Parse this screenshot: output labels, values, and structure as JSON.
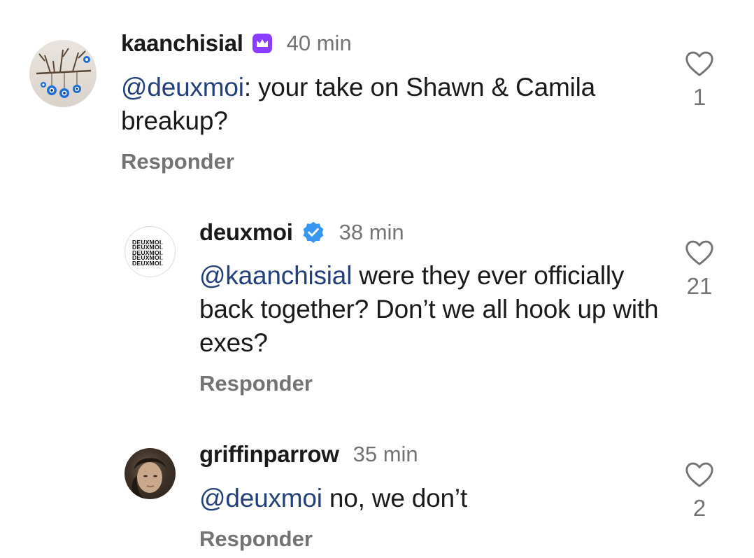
{
  "comments": [
    {
      "username": "kaanchisial",
      "badge_icon": "crown-badge-icon",
      "timestamp": "40 min",
      "mention": "@deuxmoi",
      "text_after_mention": ": your take on Shawn & Camila breakup?",
      "reply_label": "Responder",
      "likes": "1"
    },
    {
      "username": "deuxmoi",
      "badge_icon": "verified-badge-icon",
      "timestamp": "38 min",
      "avatar_text": [
        "DEUXMOI.",
        "DEUXMOI.",
        "DEUXMOI.",
        "DEUXMOI.",
        "DEUXMOI."
      ],
      "mention": "@kaanchisial",
      "text_after_mention": " were they ever officially back together? Don’t we all hook up with exes?",
      "reply_label": "Responder",
      "likes": "21"
    },
    {
      "username": "griffinparrow",
      "timestamp": "35 min",
      "mention": "@deuxmoi",
      "text_after_mention": " no, we don’t",
      "reply_label": "Responder",
      "likes": "2"
    }
  ],
  "colors": {
    "mention": "#24407a",
    "secondary_text": "#737373",
    "verified_blue": "#3897f0",
    "crown_purple": "#8b3dff"
  }
}
